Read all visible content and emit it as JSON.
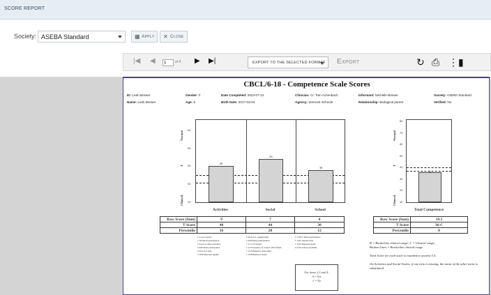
{
  "header": {
    "title": "SCORE REPORT"
  },
  "filters": {
    "society_label": "Society:",
    "society_value": "ASEBA Standard",
    "apply_label": "Apply",
    "close_label": "Close"
  },
  "viewer": {
    "page_current": "1",
    "page_of": "of 4",
    "export_format": "EXPORT TO THE SELECTED FORMAT",
    "export_label": "Export",
    "icons": [
      "first-page-icon",
      "prev-page-icon",
      "next-page-icon",
      "last-page-icon",
      "refresh-icon",
      "print-icon",
      "toggle-panel-icon"
    ]
  },
  "report": {
    "title": "CBCL/6-18 - Competence Scale Scores",
    "id_label": "ID:",
    "id": "Leah Brewer",
    "name_label": "Name:",
    "name": "Leah Brewer",
    "gender_label": "Gender:",
    "gender": "F",
    "age_label": "Age:",
    "age": "6",
    "date_completed_label": "Date Completed:",
    "date_completed": "2023-07-12",
    "birth_date_label": "Birth Date:",
    "birth_date": "2017-03-04",
    "clinician_label": "Clinician:",
    "clinician": "Cr. Tom Achenbach",
    "agency_label": "Agency:",
    "agency": "Vermont Schools",
    "informant_label": "Informant:",
    "informant": "Michelle Brewer",
    "relationship_label": "Relationship:",
    "relationship": "Biological parent",
    "society_label": "Society:",
    "society": "ASEBA Standard",
    "verified_label": "Verified:",
    "verified": "No"
  },
  "chart_data": {
    "type": "bar",
    "categories": [
      "Activities",
      "Social",
      "School",
      "Total Competence"
    ],
    "values": [
      40,
      44,
      38,
      36
    ],
    "ylim": [
      20,
      65
    ],
    "total_ylim": [
      10,
      80
    ],
    "ylabel": "T",
    "yband_labels": {
      "top": "Normal",
      "bottom": "Clinical"
    },
    "yticks_left": [
      20,
      30,
      40,
      50,
      60
    ],
    "yticks_right": [
      10,
      20,
      30,
      40,
      50,
      60,
      70,
      80
    ],
    "borderline_lines": [
      31,
      35
    ],
    "total_borderline_lines": [
      37,
      40
    ]
  },
  "scores": {
    "row_labels": [
      "Raw Score (Sum)",
      "T Score",
      "Percentile"
    ],
    "activities": [
      "9",
      "40",
      "16"
    ],
    "social": [
      "7",
      "44",
      "28"
    ],
    "school": [
      "4",
      "38",
      "12"
    ],
    "total_row_labels": [
      "Raw Score (Sum)",
      "T Score",
      "Percentile"
    ],
    "total": [
      "19.5",
      "36-C",
      "8"
    ]
  },
  "items": {
    "activities": [
      "1  I.A # of sports",
      "1  I.B Mean participation",
      "1  II.A # of other activities",
      "2  II.B Mean participation",
      "2  IV.A # of jobs",
      "1  IV.B Mean job quality"
    ],
    "social": [
      "1  III.A # of organizations",
      "1  III.B Mean participation",
      "1  V.1 # of friends",
      "1  V.2 Frequency of contact with friends",
      "1  VI.A Behavior with others",
      "1  VI.B Behavior Alone"
    ],
    "school": [
      "1.5  VII.1 Mean performance",
      "1  VII.2 Special class",
      "1  VII.3 Repeated grade",
      "0  VII.4 School problems"
    ]
  },
  "notes": {
    "legend1": "B = Borderline clinical range; C = Clinical range;",
    "legend2": "Broken Lines = Borderline clinical range",
    "rounding": "Total Score for each scale is rounded to nearest 0.5.",
    "missing": "On Activities and Social Scales, if one item is missing, the mean of the other items is substituted.",
    "box1": "For items 2,3 and 4:",
    "box2": "0 = Yes",
    "box3": "1 = No"
  }
}
